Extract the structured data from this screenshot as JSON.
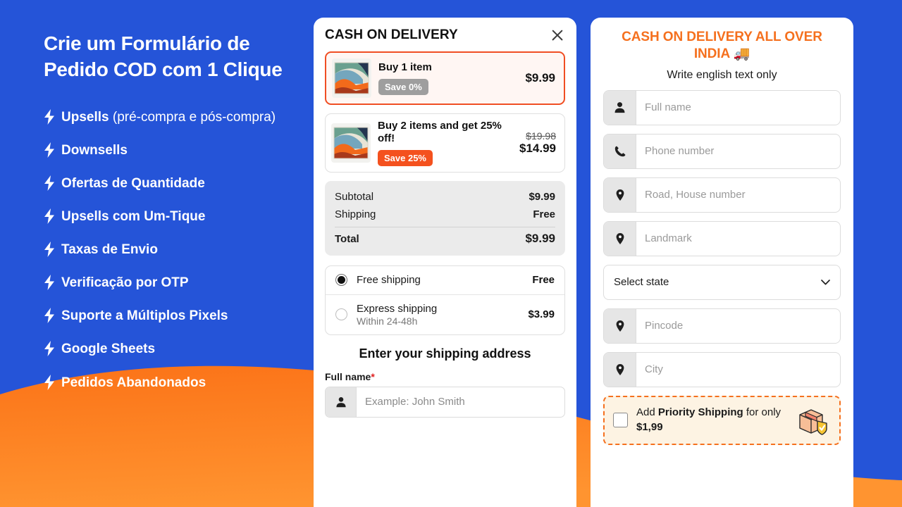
{
  "colors": {
    "blue": "#2554D8",
    "orange": "#FF8C26",
    "orange_dark": "#F5701E",
    "accent_red": "#F04E23",
    "badge_grey": "#9E9E9E",
    "badge_red": "#F4511E"
  },
  "promo": {
    "title": "Crie um Formulário de Pedido COD com 1 Clique",
    "features": [
      {
        "bold": "Upsells",
        "rest": " (pré-compra e pós-compra)"
      },
      {
        "bold": "Downsells",
        "rest": ""
      },
      {
        "bold": "Ofertas de Quantidade",
        "rest": ""
      },
      {
        "bold": "Upsells com Um-Tique",
        "rest": ""
      },
      {
        "bold": "Taxas de Envio",
        "rest": ""
      },
      {
        "bold": "Verificação por OTP",
        "rest": ""
      },
      {
        "bold": "Suporte a Múltiplos Pixels",
        "rest": ""
      },
      {
        "bold": "Google Sheets",
        "rest": ""
      },
      {
        "bold": "Pedidos Abandonados",
        "rest": ""
      }
    ]
  },
  "cart": {
    "title": "CASH ON DELIVERY",
    "close_label": "×",
    "offers": [
      {
        "name": "Buy 1 item",
        "badge": "Save 0%",
        "badge_style": "grey",
        "price": "$9.99",
        "old_price": "",
        "selected": true
      },
      {
        "name": "Buy 2 items and get 25% off!",
        "badge": "Save 25%",
        "badge_style": "red",
        "price": "$14.99",
        "old_price": "$19.98",
        "selected": false
      }
    ],
    "totals": [
      {
        "label": "Subtotal",
        "value": "$9.99"
      },
      {
        "label": "Shipping",
        "value": "Free"
      }
    ],
    "total": {
      "label": "Total",
      "value": "$9.99"
    },
    "shipping_options": [
      {
        "name": "Free shipping",
        "sub": "",
        "price": "Free",
        "selected": true
      },
      {
        "name": "Express shipping",
        "sub": "Within 24-48h",
        "price": "$3.99",
        "selected": false
      }
    ],
    "address_heading": "Enter your shipping address",
    "full_name_label": "Full name",
    "required_mark": "*",
    "full_name_placeholder": "Example: John Smith"
  },
  "form": {
    "title": "CASH ON DELIVERY ALL OVER INDIA 🚚",
    "subtitle": "Write english text only",
    "fields": [
      {
        "icon": "person-icon",
        "placeholder": "Full name"
      },
      {
        "icon": "phone-icon",
        "placeholder": "Phone number"
      },
      {
        "icon": "pin-icon",
        "placeholder": "Road, House number"
      },
      {
        "icon": "pin-icon",
        "placeholder": "Landmark"
      }
    ],
    "state_select": "Select state",
    "fields_after": [
      {
        "icon": "pin-icon",
        "placeholder": "Pincode"
      },
      {
        "icon": "pin-icon",
        "placeholder": "City"
      }
    ],
    "priority": {
      "prefix": "Add ",
      "strong": "Priority Shipping",
      "middle": " for only ",
      "price": "$1,99",
      "checked": false
    }
  }
}
